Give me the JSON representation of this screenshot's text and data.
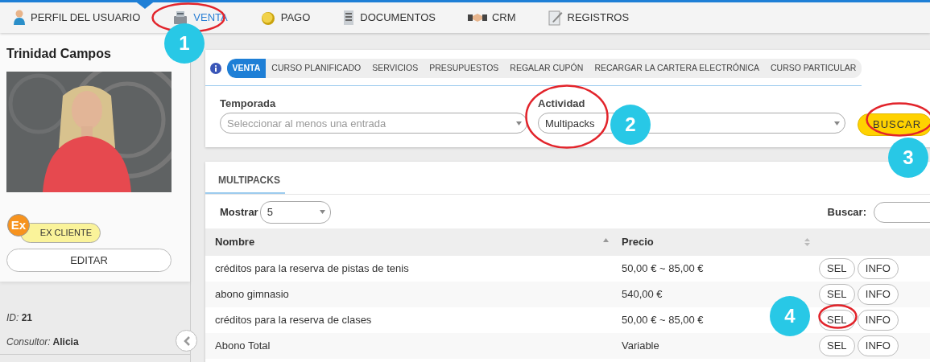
{
  "top_nav": {
    "items": [
      {
        "label": "PERFIL DEL USUARIO",
        "selected": false
      },
      {
        "label": "VENTA",
        "selected": true
      },
      {
        "label": "PAGO",
        "selected": false
      },
      {
        "label": "DOCUMENTOS",
        "selected": false
      },
      {
        "label": "CRM",
        "selected": false
      },
      {
        "label": "REGISTROS",
        "selected": false
      }
    ]
  },
  "profile": {
    "name": "Trinidad Campos",
    "status": {
      "code": "Ex",
      "label": "EX CLIENTE"
    },
    "edit_button": "EDITAR",
    "details": [
      {
        "label": "ID:",
        "value": "21"
      },
      {
        "label": "Consultor:",
        "value": "Alicia"
      }
    ]
  },
  "sales_tabs": [
    {
      "label": "VENTA",
      "selected": true
    },
    {
      "label": "CURSO PLANIFICADO",
      "selected": false
    },
    {
      "label": "SERVICIOS",
      "selected": false
    },
    {
      "label": "PRESUPUESTOS",
      "selected": false
    },
    {
      "label": "REGALAR CUPÓN",
      "selected": false
    },
    {
      "label": "RECARGAR LA CARTERA ELECTRÓNICA",
      "selected": false
    },
    {
      "label": "CURSO PARTICULAR",
      "selected": false
    }
  ],
  "filters": {
    "season": {
      "label": "Temporada",
      "placeholder": "Seleccionar al menos una entrada"
    },
    "activity": {
      "label": "Actividad",
      "value": "Multipacks"
    },
    "search_button": "BUSCAR"
  },
  "table_panel": {
    "tab": "MULTIPACKS",
    "show_label": "Mostrar",
    "show_value": "5",
    "search_label": "Buscar:",
    "columns": [
      {
        "label": "Nombre",
        "sorted": true
      },
      {
        "label": "Precio",
        "sorted": false
      }
    ],
    "rows": [
      {
        "name": "créditos para la reserva de pistas de tenis",
        "price": "50,00 € ~ 85,00 €",
        "buttons": [
          "SEL",
          "INFO"
        ]
      },
      {
        "name": "abono gimnasio",
        "price": "540,00 €",
        "buttons": [
          "SEL",
          "INFO"
        ]
      },
      {
        "name": "créditos para la reserva de clases",
        "price": "50,00 € ~ 85,00 €",
        "buttons": [
          "SEL",
          "INFO"
        ]
      },
      {
        "name": "Abono Total",
        "price": "Variable",
        "buttons": [
          "SEL",
          "INFO"
        ]
      }
    ]
  },
  "annotations": [
    {
      "label": "1"
    },
    {
      "label": "2"
    },
    {
      "label": "3"
    },
    {
      "label": "4"
    }
  ]
}
